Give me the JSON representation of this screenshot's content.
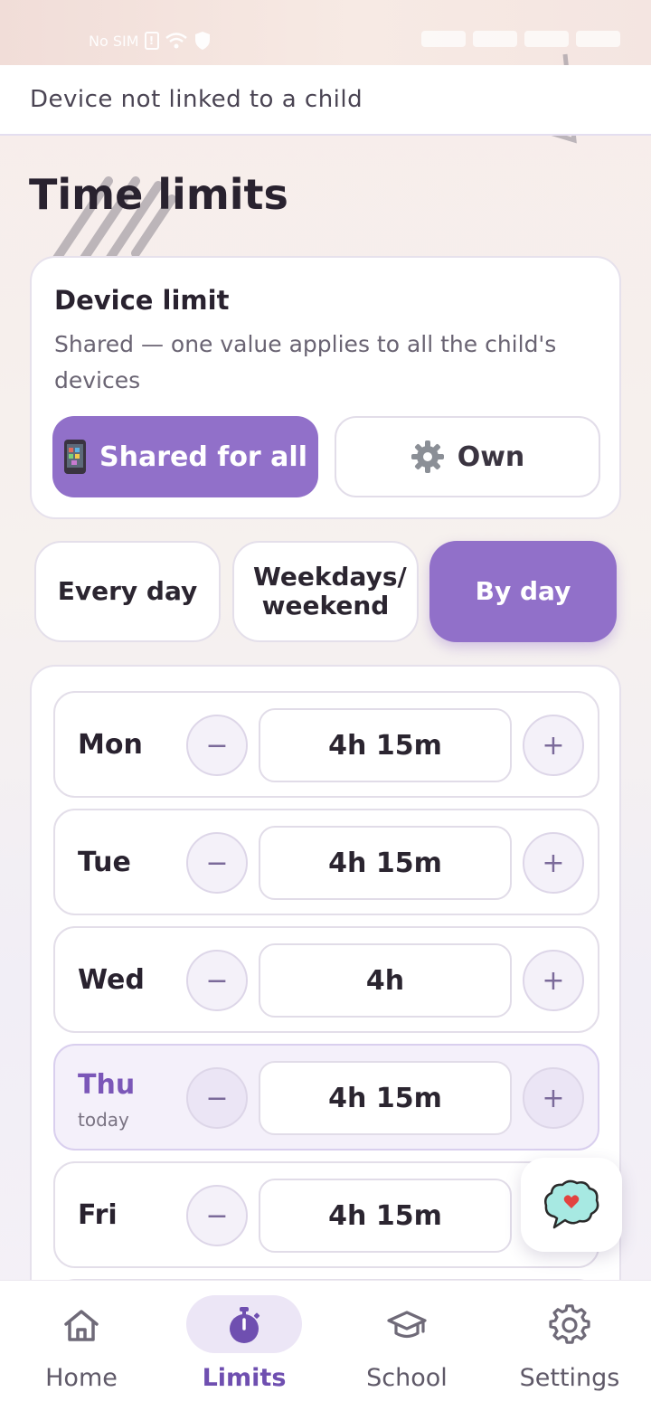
{
  "status_bar": {
    "left_text": "No SIM"
  },
  "banner": {
    "text": "Device not linked to a child"
  },
  "page": {
    "title": "Time limits"
  },
  "device_limit": {
    "heading": "Device limit",
    "description": "Shared — one value applies to all the child's devices",
    "options": [
      {
        "label": "Shared for all",
        "icon": "phone-icon",
        "selected": true
      },
      {
        "label": "Own",
        "icon": "gear-icon",
        "selected": false
      }
    ]
  },
  "modes": [
    {
      "label": "Every day",
      "selected": false
    },
    {
      "label": "Weekdays/ weekend",
      "selected": false
    },
    {
      "label": "By day",
      "selected": true
    }
  ],
  "days": [
    {
      "name": "Mon",
      "sub": "",
      "value": "4h 15m",
      "today": false
    },
    {
      "name": "Tue",
      "sub": "",
      "value": "4h 15m",
      "today": false
    },
    {
      "name": "Wed",
      "sub": "",
      "value": "4h",
      "today": false
    },
    {
      "name": "Thu",
      "sub": "today",
      "value": "4h 15m",
      "today": true
    },
    {
      "name": "Fri",
      "sub": "",
      "value": "4h 15m",
      "today": false
    }
  ],
  "stepper": {
    "minus": "−",
    "plus": "+"
  },
  "chat": {
    "icon": "chat-heart-icon"
  },
  "nav": {
    "items": [
      {
        "label": "Home",
        "icon": "home-icon",
        "active": false
      },
      {
        "label": "Limits",
        "icon": "stopwatch-icon",
        "active": true
      },
      {
        "label": "School",
        "icon": "graduation-cap-icon",
        "active": false
      },
      {
        "label": "Settings",
        "icon": "gear-icon",
        "active": false
      }
    ]
  },
  "colors": {
    "accent": "#9170c9",
    "accent_text": "#7b57b8",
    "title": "#29222f"
  }
}
